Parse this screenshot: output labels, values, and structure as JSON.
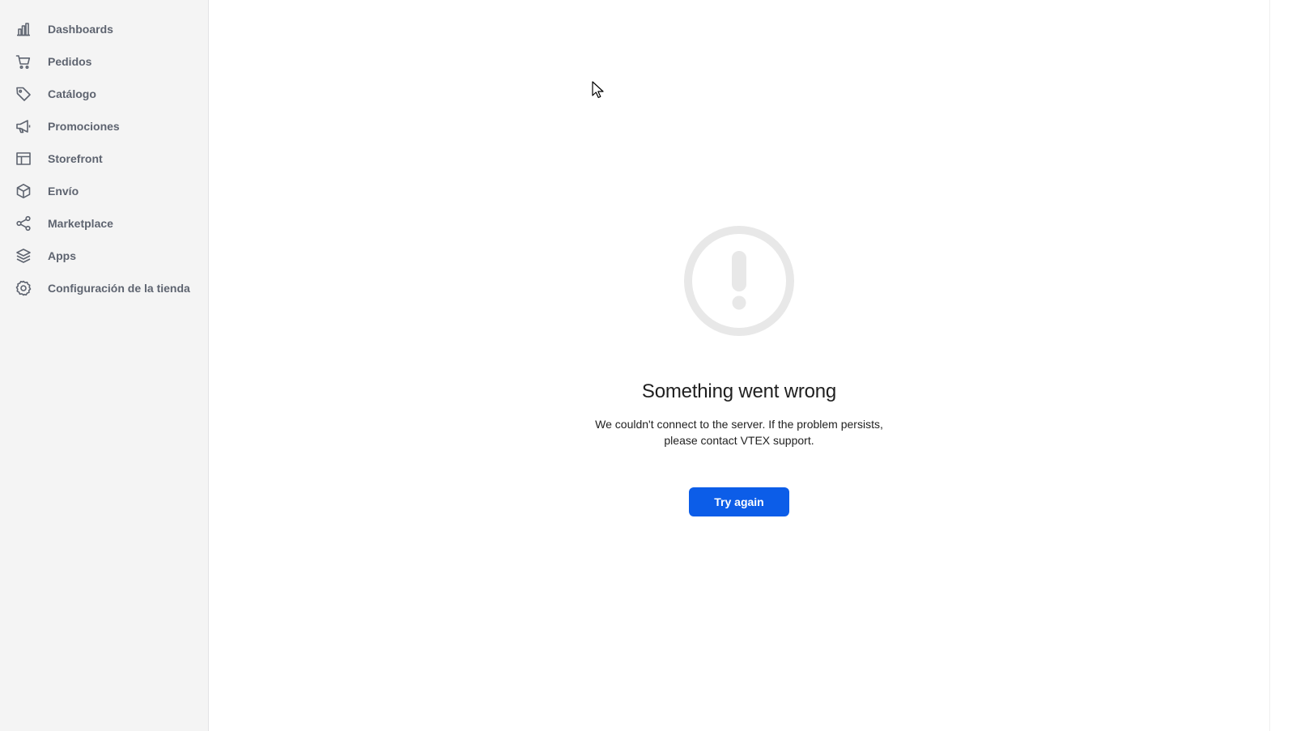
{
  "sidebar": {
    "items": [
      {
        "label": "Dashboards",
        "icon": "bar-chart-icon"
      },
      {
        "label": "Pedidos",
        "icon": "cart-icon"
      },
      {
        "label": "Catálogo",
        "icon": "tag-icon"
      },
      {
        "label": "Promociones",
        "icon": "megaphone-icon"
      },
      {
        "label": "Storefront",
        "icon": "layout-icon"
      },
      {
        "label": "Envío",
        "icon": "box-icon"
      },
      {
        "label": "Marketplace",
        "icon": "share-icon"
      },
      {
        "label": "Apps",
        "icon": "layers-icon"
      },
      {
        "label": "Configuración de la tienda",
        "icon": "gear-icon"
      }
    ]
  },
  "error": {
    "icon": "exclamation-circle-icon",
    "title": "Something went wrong",
    "message": "We couldn't connect to the server. If the problem persists, please contact VTEX support.",
    "retry_label": "Try again"
  },
  "colors": {
    "sidebar_bg": "#f4f4f4",
    "nav_text": "#5e6470",
    "primary": "#0c5de8",
    "icon_gray": "#e8e8e8"
  }
}
